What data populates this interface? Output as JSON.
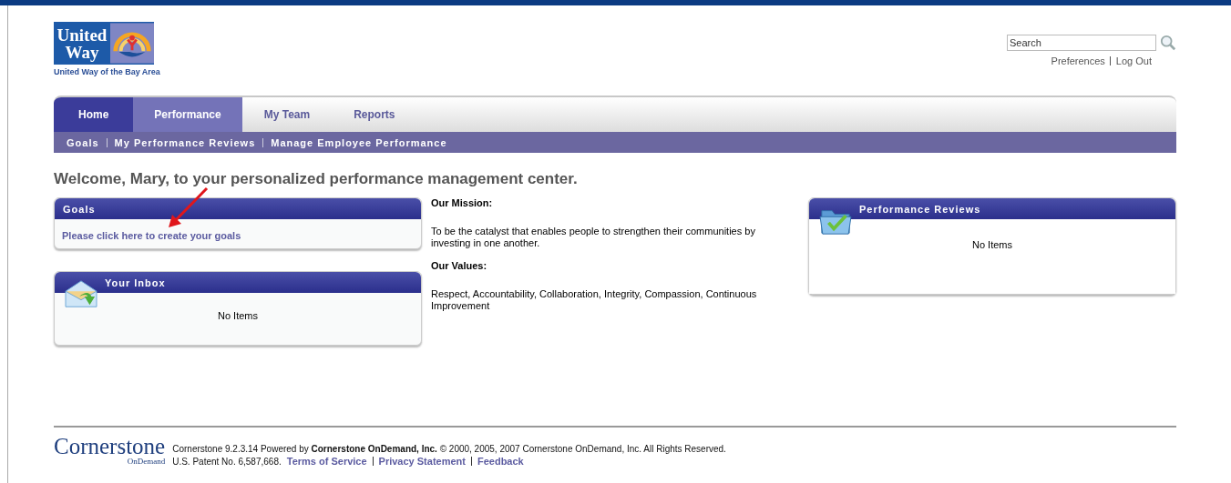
{
  "logo": {
    "line_1": "United",
    "line_2": "Way",
    "caption": "United Way of the Bay Area"
  },
  "search": {
    "placeholder": "Search"
  },
  "user_links": [
    "Preferences",
    "Log Out"
  ],
  "tabs": [
    {
      "label": "Home",
      "kind": "home",
      "selected": false
    },
    {
      "label": "Performance",
      "kind": "normal",
      "selected": true
    },
    {
      "label": "My Team",
      "kind": "normal",
      "selected": false
    },
    {
      "label": "Reports",
      "kind": "normal",
      "selected": false
    }
  ],
  "subnav": [
    "Goals",
    "My Performance Reviews",
    "Manage Employee Performance"
  ],
  "welcome": "Welcome, Mary, to your personalized performance management center.",
  "goals": {
    "title": "Goals",
    "link": "Please click here to create your goals"
  },
  "inbox": {
    "title": "Your Inbox",
    "empty": "No Items"
  },
  "mission": {
    "heading": "Our Mission:",
    "text": "To be the catalyst that enables people to strengthen their communities by investing in one another.",
    "values_heading": "Our Values:",
    "values": "Respect, Accountability, Collaboration, Integrity, Compassion, Continuous Improvement"
  },
  "reviews": {
    "title": "Performance Reviews",
    "empty": "No Items"
  },
  "footer": {
    "brand": "Cornerstone",
    "brand_sub": "OnDemand",
    "line_1": "Cornerstone 9.2.3.14 Powered by **Cornerstone OnDemand, Inc.** © 2000, 2005, 2007 Cornerstone OnDemand, Inc. All Rights Reserved.",
    "patent": "U.S. Patent No. 6,587,668.",
    "links": [
      "Terms of Service",
      "Privacy Statement",
      "Feedback"
    ]
  }
}
